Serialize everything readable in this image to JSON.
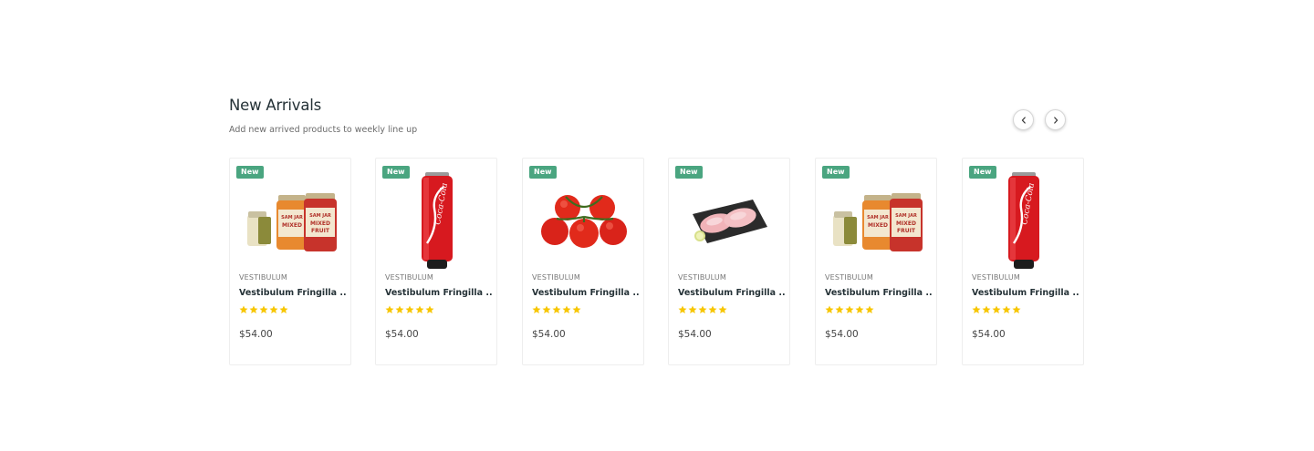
{
  "section": {
    "title": "New Arrivals",
    "subtitle": "Add new arrived products to weekly line up"
  },
  "nav": {
    "prev_icon": "chevron-left-icon",
    "next_icon": "chevron-right-icon"
  },
  "colors": {
    "badge": "#4aa580",
    "star": "#f7c600",
    "title": "#253237"
  },
  "products": [
    {
      "badge": "New",
      "image": "jam-jars",
      "vendor": "VESTIBULUM",
      "name": "Vestibulum Fringilla ...",
      "rating": 5,
      "price": "$54.00"
    },
    {
      "badge": "New",
      "image": "cola-can",
      "vendor": "VESTIBULUM",
      "name": "Vestibulum Fringilla ...",
      "rating": 5,
      "price": "$54.00"
    },
    {
      "badge": "New",
      "image": "tomatoes",
      "vendor": "VESTIBULUM",
      "name": "Vestibulum Fringilla ...",
      "rating": 5,
      "price": "$54.00"
    },
    {
      "badge": "New",
      "image": "fish-fillet",
      "vendor": "VESTIBULUM",
      "name": "Vestibulum Fringilla ...",
      "rating": 5,
      "price": "$54.00"
    },
    {
      "badge": "New",
      "image": "jam-jars",
      "vendor": "VESTIBULUM",
      "name": "Vestibulum Fringilla ...",
      "rating": 5,
      "price": "$54.00"
    },
    {
      "badge": "New",
      "image": "cola-can",
      "vendor": "VESTIBULUM",
      "name": "Vestibulum Fringilla ...",
      "rating": 5,
      "price": "$54.00"
    }
  ]
}
